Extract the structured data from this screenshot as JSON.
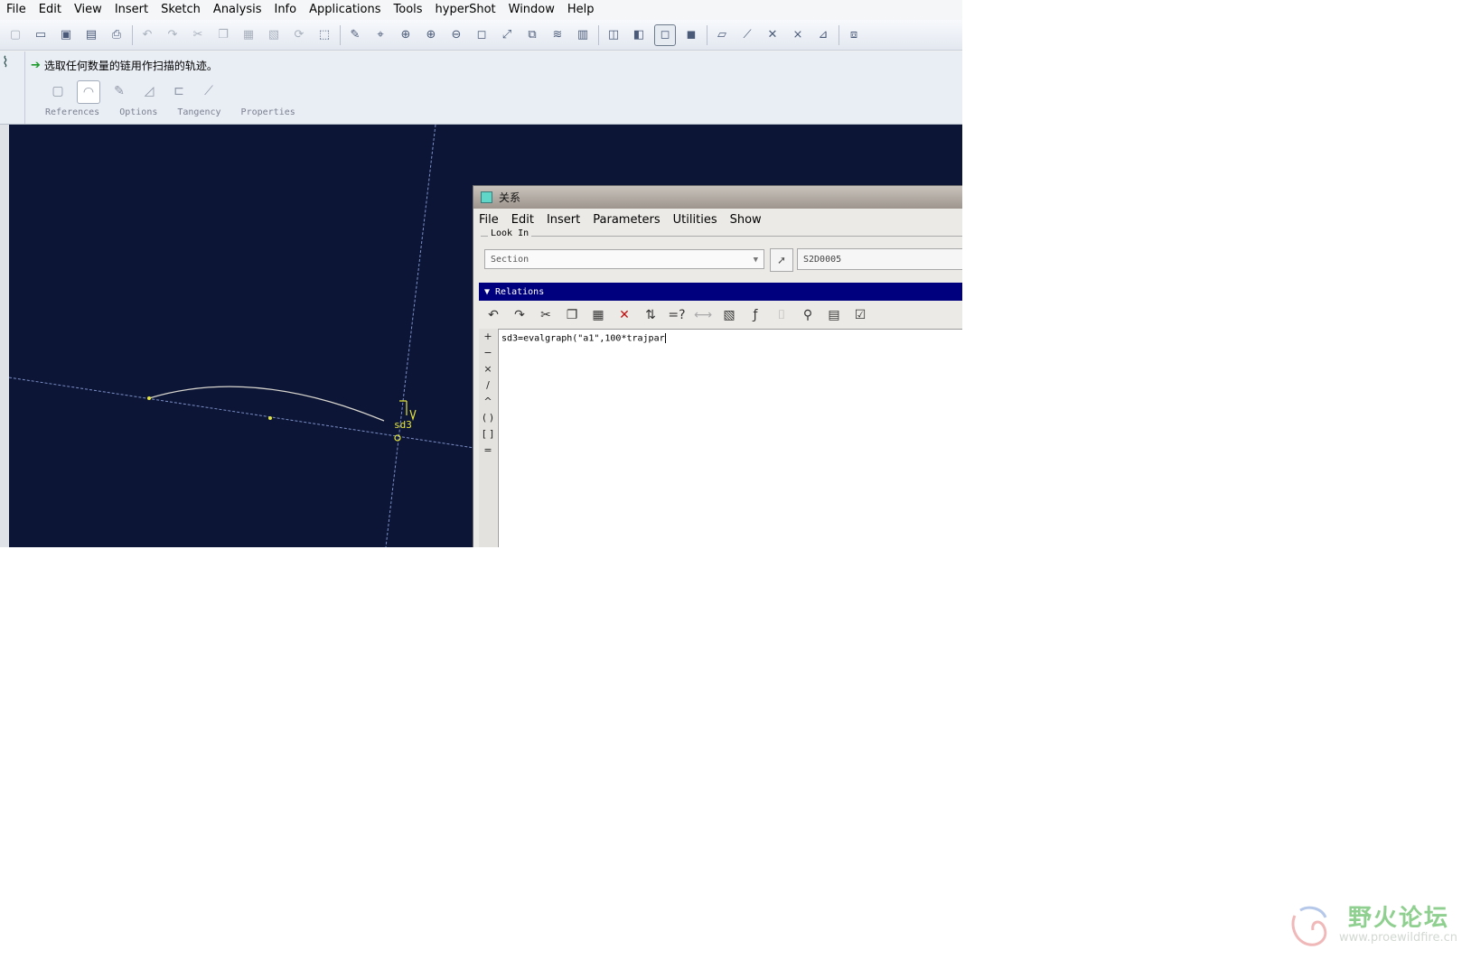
{
  "menubar": [
    "File",
    "Edit",
    "View",
    "Insert",
    "Sketch",
    "Analysis",
    "Info",
    "Applications",
    "Tools",
    "hyperShot",
    "Window",
    "Help"
  ],
  "toolbar": {
    "icons": [
      "new-icon",
      "open-icon",
      "save-icon",
      "save-copy-icon",
      "print-icon",
      "sep",
      "undo-icon",
      "redo-icon",
      "cut-icon",
      "copy-icon",
      "paste-icon",
      "paste-special-icon",
      "regenerate-icon",
      "select-box-icon",
      "sep",
      "sketcher-icon",
      "datum-icon",
      "zoom-fit-icon",
      "zoom-in-icon",
      "zoom-out-icon",
      "refit-icon",
      "reorient-icon",
      "named-view-icon",
      "layers-icon",
      "view-manager-icon",
      "sep",
      "wireframe-icon",
      "hidden-line-icon",
      "no-hidden-icon",
      "shading-icon",
      "sep",
      "datum-planes-icon",
      "datum-axes-icon",
      "datum-points-icon",
      "csys-icon",
      "annotations-icon",
      "sep",
      "spin-center-icon"
    ]
  },
  "dashboard": {
    "prompt": "选取任何数量的链用作扫描的轨迹。",
    "tabs": [
      "References",
      "Options",
      "Tangency",
      "Properties"
    ]
  },
  "sketch": {
    "dimension_label": "sd3"
  },
  "dialog": {
    "title": "关系",
    "menu": [
      "File",
      "Edit",
      "Insert",
      "Parameters",
      "Utilities",
      "Show"
    ],
    "look_in": {
      "label": "Look In",
      "select_value": "Section",
      "field_value": "S2D0005"
    },
    "relations_header": "Relations",
    "operators": [
      "+",
      "−",
      "×",
      "/",
      "^",
      "( )",
      "[ ]",
      "="
    ],
    "relation_text": "sd3=evalgraph(\"a1\",100*trajpar"
  },
  "watermark": {
    "name": "野火论坛",
    "url": "www.proewildfire.cn"
  }
}
